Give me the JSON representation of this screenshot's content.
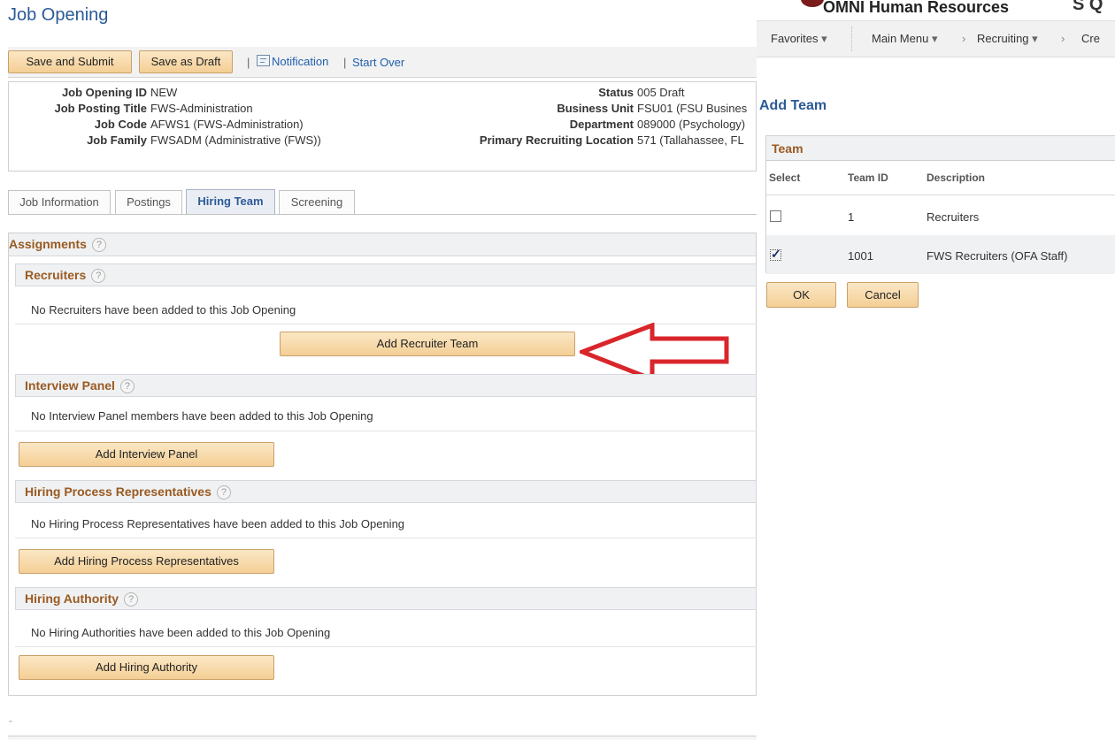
{
  "page": {
    "title": "Job Opening",
    "toolbar": {
      "save_submit": "Save and Submit",
      "save_draft": "Save as Draft",
      "sep": "|",
      "notification": "Notification",
      "start_over": "Start Over"
    },
    "summary": {
      "job_opening_id_label": "Job Opening ID",
      "job_opening_id": "NEW",
      "job_posting_title_label": "Job Posting Title",
      "job_posting_title": "FWS-Administration",
      "job_code_label": "Job Code",
      "job_code": "AFWS1 (FWS-Administration)",
      "job_family_label": "Job Family",
      "job_family": "FWSADM (Administrative (FWS))",
      "status_label": "Status",
      "status": "005 Draft",
      "business_unit_label": "Business Unit",
      "business_unit": "FSU01 (FSU Busines",
      "department_label": "Department",
      "department": "089000 (Psychology)",
      "location_label": "Primary Recruiting Location",
      "location": "571 (Tallahassee, FL"
    },
    "tabs": [
      {
        "label": "Job Information",
        "active": false
      },
      {
        "label": "Postings",
        "active": false
      },
      {
        "label": "Hiring Team",
        "active": true
      },
      {
        "label": "Screening",
        "active": false
      }
    ],
    "assignments": {
      "title": "Assignments",
      "help": "?",
      "recruiters": {
        "title": "Recruiters",
        "empty": "No Recruiters have been added to this Job Opening",
        "button": "Add Recruiter Team"
      },
      "interview": {
        "title": "Interview Panel",
        "empty": "No Interview Panel members have been added to this Job Opening",
        "button": "Add Interview Panel"
      },
      "hiring_reps": {
        "title": "Hiring Process Representatives",
        "empty": "No Hiring Process Representatives have been added to this Job Opening",
        "button": "Add Hiring Process Representatives"
      },
      "hiring_authority": {
        "title": "Hiring Authority",
        "empty": "No Hiring Authorities have been added to this Job Opening",
        "button": "Add Hiring Authority"
      }
    },
    "footer_dash": "-"
  },
  "omni": {
    "title": "OMNI Human Resources",
    "cut_text": "S Q",
    "nav": {
      "favorites": "Favorites",
      "main_menu": "Main Menu",
      "recruiting": "Recruiting",
      "create": "Cre",
      "caret": "▾",
      "chevron": "›"
    },
    "modal": {
      "title": "Add Team",
      "grid_title": "Team",
      "columns": [
        "Select",
        "Team ID",
        "Description"
      ],
      "rows": [
        {
          "team_id": "1",
          "description": "Recruiters",
          "selected": false
        },
        {
          "team_id": "1001",
          "description": "FWS Recruiters (OFA Staff)",
          "selected": true
        }
      ],
      "ok": "OK",
      "cancel": "Cancel"
    }
  },
  "colors": {
    "accent_blue": "#2b5a96",
    "section_title": "#9a5a20",
    "button_fill": "#f4cf95",
    "arrow_red": "#d9262b"
  }
}
